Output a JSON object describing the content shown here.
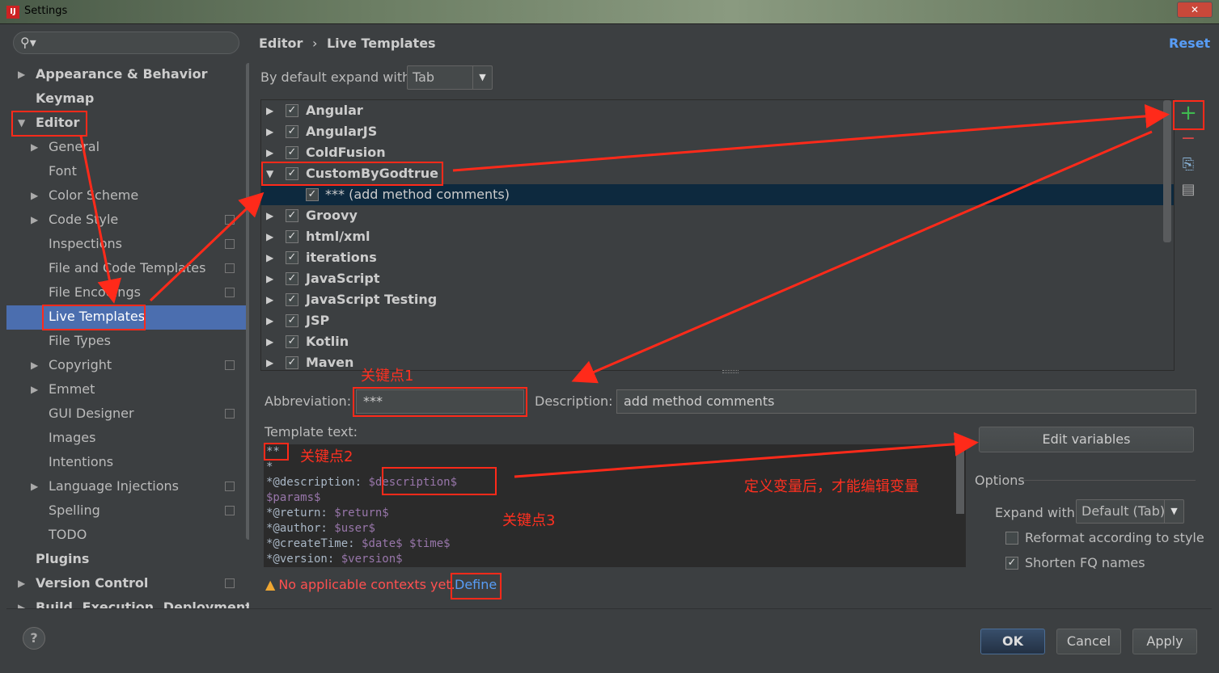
{
  "window": {
    "title": "Settings",
    "close_label": "✕"
  },
  "sidebar": {
    "search_placeholder": "",
    "items": [
      {
        "label": "Appearance & Behavior"
      },
      {
        "label": "Keymap"
      },
      {
        "label": "Editor"
      },
      {
        "label": "General"
      },
      {
        "label": "Font"
      },
      {
        "label": "Color Scheme"
      },
      {
        "label": "Code Style"
      },
      {
        "label": "Inspections"
      },
      {
        "label": "File and Code Templates"
      },
      {
        "label": "File Encodings"
      },
      {
        "label": "Live Templates"
      },
      {
        "label": "File Types"
      },
      {
        "label": "Copyright"
      },
      {
        "label": "Emmet"
      },
      {
        "label": "GUI Designer"
      },
      {
        "label": "Images"
      },
      {
        "label": "Intentions"
      },
      {
        "label": "Language Injections"
      },
      {
        "label": "Spelling"
      },
      {
        "label": "TODO"
      },
      {
        "label": "Plugins"
      },
      {
        "label": "Version Control"
      },
      {
        "label": "Build, Execution, Deployment"
      }
    ]
  },
  "header": {
    "crumb_root": "Editor",
    "crumb_sep": "›",
    "crumb_current": "Live Templates",
    "reset_label": "Reset"
  },
  "expand": {
    "label": "By default expand with",
    "value": "Tab"
  },
  "groups": [
    {
      "label": "Angular",
      "checked": true
    },
    {
      "label": "AngularJS",
      "checked": true
    },
    {
      "label": "ColdFusion",
      "checked": true
    },
    {
      "label": "CustomByGodtrue",
      "checked": true
    },
    {
      "label": "*** (add method comments)",
      "checked": true
    },
    {
      "label": "Groovy",
      "checked": true
    },
    {
      "label": "html/xml",
      "checked": true
    },
    {
      "label": "iterations",
      "checked": true
    },
    {
      "label": "JavaScript",
      "checked": true
    },
    {
      "label": "JavaScript Testing",
      "checked": true
    },
    {
      "label": "JSP",
      "checked": true
    },
    {
      "label": "Kotlin",
      "checked": true
    },
    {
      "label": "Maven",
      "checked": true
    }
  ],
  "abbreviation": {
    "label": "Abbreviation:",
    "value": "***"
  },
  "description": {
    "label": "Description:",
    "value": "add method comments"
  },
  "template_text": {
    "label": "Template text:",
    "lines": [
      {
        "text": "**"
      },
      {
        "text": "*"
      },
      {
        "text": "*@description: ",
        "var": "$description$"
      },
      {
        "text": "",
        "var": "$params$"
      },
      {
        "text": "*@return: ",
        "var": "$return$"
      },
      {
        "text": "*@author: ",
        "var": "$user$"
      },
      {
        "text": "*@createTime: ",
        "var": "$date$ $time$"
      },
      {
        "text": "*@version: ",
        "var": "$version$"
      }
    ]
  },
  "edit_variables_label": "Edit variables",
  "options": {
    "title": "Options",
    "expand_label": "Expand with",
    "expand_value": "Default (Tab)",
    "reformat_label": "Reformat according to style",
    "reformat_checked": false,
    "shorten_label": "Shorten FQ names",
    "shorten_checked": true
  },
  "warning": {
    "text": "No applicable contexts yet.",
    "link": "Define"
  },
  "annotations": {
    "key1": "关键点1",
    "key2": "关键点2",
    "key3": "关键点3",
    "note": "定义变量后，才能编辑变量"
  },
  "footer": {
    "ok": "OK",
    "cancel": "Cancel",
    "apply": "Apply",
    "help": "?"
  },
  "colors": {
    "accent": "#4b6eaf",
    "link": "#589df6",
    "annotation": "#ff2a1a",
    "add": "#3fb950",
    "remove": "#d64545"
  }
}
